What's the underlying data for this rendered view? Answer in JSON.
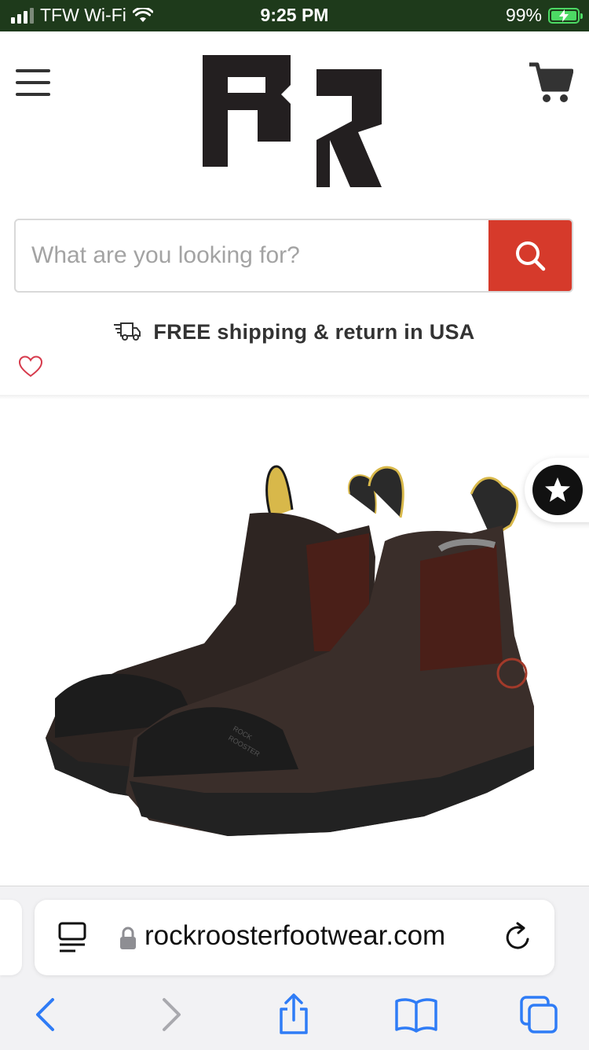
{
  "status_bar": {
    "carrier": "TFW Wi-Fi",
    "time": "9:25 PM",
    "battery_percent": "99%",
    "signal_bars_active": 3,
    "signal_bars_total": 4,
    "wifi_icon": "wifi-icon",
    "battery_icon": "battery-charging-icon"
  },
  "header": {
    "menu_icon": "hamburger-menu-icon",
    "logo": "rock-rooster-logo",
    "cart_icon": "shopping-cart-icon"
  },
  "search": {
    "placeholder": "What are you looking for?",
    "value": "",
    "button_icon": "search-icon",
    "button_color": "#d63a2b"
  },
  "shipping": {
    "icon": "delivery-truck-icon",
    "text": "FREE shipping & return in USA"
  },
  "wishlist": {
    "icon": "heart-icon",
    "color": "#d6394b"
  },
  "product": {
    "image": "brown-chelsea-work-boots",
    "reviews_icon": "star-icon"
  },
  "browser": {
    "url": "rockroosterfootwear.com",
    "reader_icon": "reader-mode-icon",
    "lock_icon": "lock-icon",
    "reload_icon": "reload-icon",
    "toolbar": [
      "back-icon",
      "forward-icon",
      "share-icon",
      "bookmarks-icon",
      "tabs-icon"
    ],
    "accent": "#2f7cf6"
  }
}
